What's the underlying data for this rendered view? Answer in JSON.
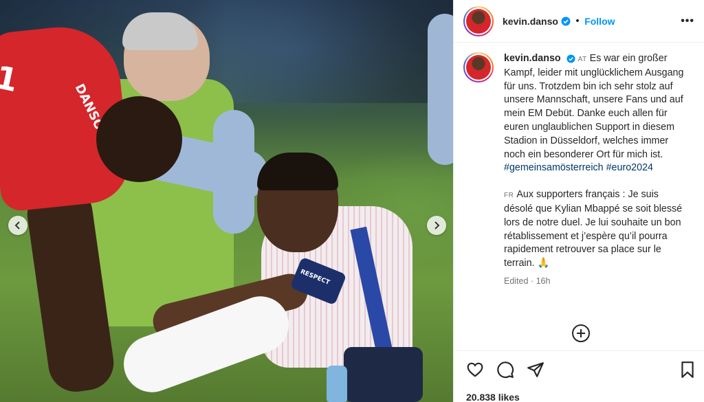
{
  "post": {
    "username": "kevin.danso",
    "follow_label": "Follow",
    "caption": {
      "lang_at": "AT",
      "text_at": "Es war ein großer Kampf, leider mit unglücklichem Ausgang für uns. Trotzdem bin ich sehr stolz auf unsere Mannschaft, unsere Fans und auf mein EM Debüt. Danke euch allen für euren unglaublichen Support in diesem Stadion in Düsseldorf, welches immer noch ein besonderer Ort für mich ist.",
      "hashtag1": "#gemeinsamösterreich",
      "hashtag2": "#euro2024",
      "lang_fr": "FR",
      "text_fr": "Aux supporters français : Je suis désolé que Kylian Mbappé se soit blessé lors de notre duel. Je lui souhaite un bon rétablissement et j’espère qu’il pourra rapidement retrouver sa place sur le terrain.",
      "emoji": "🙏"
    },
    "edited_label": "Edited",
    "time_ago": "16h",
    "likes": "20.838 likes"
  },
  "media": {
    "jersey_number": "1",
    "jersey_name": "DANSO",
    "armband_text": "RESPECT"
  },
  "icons": {
    "verified": "verified-badge-icon",
    "more": "more-options-icon",
    "prev": "chevron-left-icon",
    "next": "chevron-right-icon",
    "like": "heart-icon",
    "comment": "comment-icon",
    "share": "send-icon",
    "save": "bookmark-icon",
    "add": "add-comment-icon"
  },
  "colors": {
    "accent": "#0095f6",
    "hashtag": "#00376b",
    "muted": "#737373",
    "text": "#262626"
  }
}
